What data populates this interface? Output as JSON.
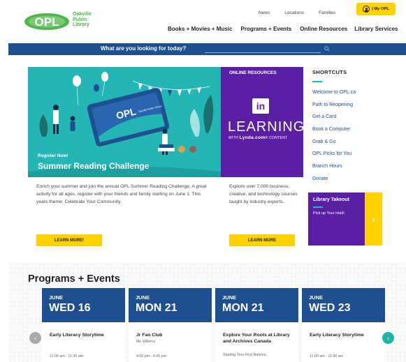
{
  "logo": {
    "badge_text": "OPL",
    "line1": "Oakville",
    "line2": "Public",
    "line3": "Library"
  },
  "util_nav": [
    "News",
    "Locations",
    "Families"
  ],
  "my_opl_label": "| My OPL",
  "main_nav": [
    "Books + Movies + Music",
    "Programs + Events",
    "Online Resources",
    "Library Services"
  ],
  "search": {
    "label": "What are you looking for today?"
  },
  "hero": {
    "small": "Register Now!",
    "title": "Summer Reading Challenge",
    "card_text": "OPL",
    "card_text2": "Oakville Public Library",
    "body": "Enrich your summer and join the annual OPL Summer Reading Challenge. A great activity for all ages, register with your friends and family starting on June 1. This years theme: Celebrate Your Community.",
    "button": "LEARN MORE!"
  },
  "lynda": {
    "title": "ONLINE RESOURCES",
    "logo_mark": "in",
    "learning": "LEARNING",
    "sub_prefix": "WITH ",
    "sub_brand": "Lynda.com",
    "sub_suffix": "® CONTENT",
    "body": "Explore over 7,000 business, creative, and technology courses taught by industry experts.",
    "button": "LEARN MORE"
  },
  "shortcuts": {
    "title": "SHORTCUTS",
    "items": [
      "Welcome to OPL.ca",
      "Path to Reopening",
      "Get a Card",
      "Book a Computer",
      "Grab & Go",
      "OPL Picks for You",
      "Branch Hours",
      "Donate"
    ]
  },
  "takeout": {
    "title": "Library Takeout",
    "sub": "Pick up Your Hold!",
    "arrow": "›"
  },
  "programs": {
    "title": "Programs + Events",
    "prev": "‹",
    "next": "›",
    "events": [
      {
        "month": "JUNE",
        "day": "WED 16",
        "title": "Early Literacy Storytime",
        "sub": "",
        "time": "11:00 am - 11:30 am"
      },
      {
        "month": "JUNE",
        "day": "MON 21",
        "title": "Jr Fan Club",
        "sub": "Mo Willems",
        "time": "4:00 pm - 4:45 pm"
      },
      {
        "month": "JUNE",
        "day": "MON 21",
        "title": "Explore Your Roots at Library and Archives Canada",
        "sub": "Starting Your First Nations,",
        "time": ""
      },
      {
        "month": "JUNE",
        "day": "WED 23",
        "title": "Early Literacy Storytime",
        "sub": "",
        "time": "11:00 am - 11:30 am"
      }
    ]
  },
  "colors": {
    "navy": "#1d4f91",
    "teal": "#24b6b4",
    "purple": "#5b1fa5",
    "yellow": "#ffd200",
    "green": "#4db748"
  }
}
